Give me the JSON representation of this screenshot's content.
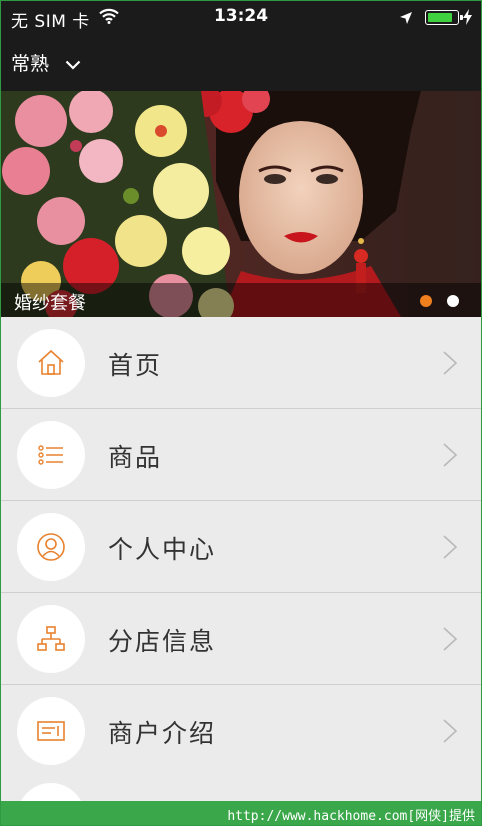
{
  "status_bar": {
    "carrier": "无 SIM 卡",
    "time": "13:24",
    "battery_level": 0.9,
    "icons": [
      "wifi-icon",
      "location-arrow-icon",
      "battery-icon",
      "charging-bolt-icon"
    ]
  },
  "nav": {
    "city": "常熟",
    "city_icon": "chevron-down-icon"
  },
  "banner": {
    "caption": "婚纱套餐",
    "page_count": 2,
    "active_page": 1,
    "active_dot_color": "#f07f1e",
    "inactive_dot_color": "#ffffff"
  },
  "menu": {
    "items": [
      {
        "label": "首页",
        "icon": "home-icon"
      },
      {
        "label": "商品",
        "icon": "list-icon"
      },
      {
        "label": "个人中心",
        "icon": "user-icon"
      },
      {
        "label": "分店信息",
        "icon": "branch-tree-icon"
      },
      {
        "label": "商户介绍",
        "icon": "merchant-card-icon"
      }
    ],
    "accent_color": "#e8822e"
  },
  "footer": {
    "text": "http://www.hackhome.com[网侠]提供"
  }
}
